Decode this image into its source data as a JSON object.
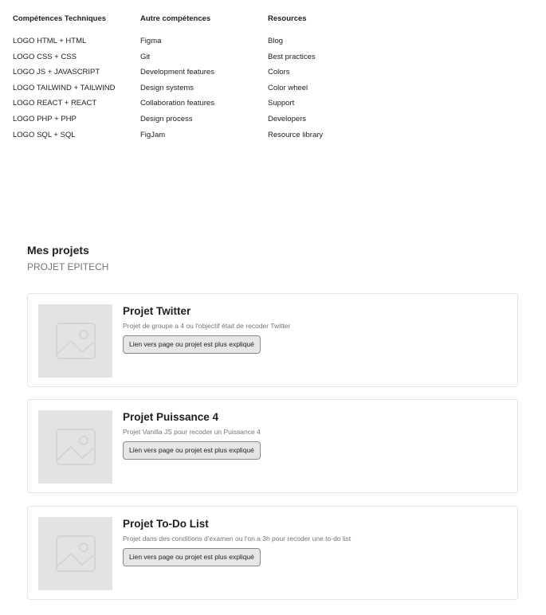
{
  "skills": {
    "columns": [
      {
        "title": "Compétences Techniques",
        "items": [
          "LOGO HTML + HTML",
          "LOGO CSS + CSS",
          "LOGO JS + JAVASCRIPT",
          "LOGO TAILWIND + TAILWIND",
          "LOGO REACT + REACT",
          "LOGO PHP + PHP",
          "LOGO SQL + SQL"
        ]
      },
      {
        "title": "Autre compétences",
        "items": [
          "Figma",
          "Git",
          "Development features",
          "Design systems",
          "Collaboration features",
          "Design process",
          "FigJam"
        ]
      },
      {
        "title": "Resources",
        "items": [
          "Blog",
          "Best practices",
          "Colors",
          "Color wheel",
          "Support",
          "Developers",
          "Resource library"
        ]
      }
    ]
  },
  "projects": {
    "title": "Mes projets",
    "subtitle": "PROJET EPITECH",
    "cards": [
      {
        "title": "Projet Twitter",
        "description": "Projet de groupe a 4 ou l'objectif était de recoder Twitter",
        "button": "Lien vers page ou projet est plus expliqué",
        "image_icon": "image-placeholder-icon"
      },
      {
        "title": "Projet Puissance 4",
        "description": "Projet Vanilla JS pour recoder un Puissance 4",
        "button": "Lien vers page ou projet est plus expliqué",
        "image_icon": "image-placeholder-icon"
      },
      {
        "title": "Projet To-Do List",
        "description": "Projet dans des conditions d'examen ou l'on a 3h pour recoder une to-do list",
        "button": "Lien vers page ou projet est plus expliqué",
        "image_icon": "image-placeholder-icon"
      }
    ]
  },
  "colors": {
    "text": "#1e1e1e",
    "muted": "#757575",
    "border": "#e3e3e3",
    "placeholder": "#e3e3e3",
    "button_bg": "#e6e6e6"
  }
}
